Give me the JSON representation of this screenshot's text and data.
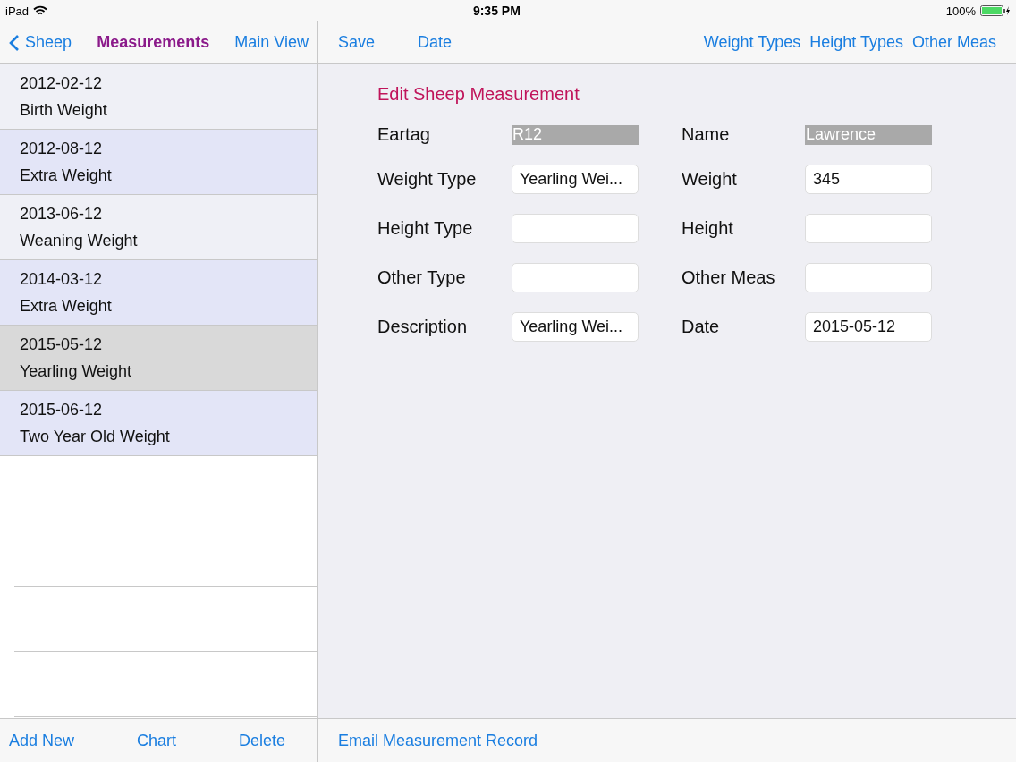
{
  "status_bar": {
    "device": "iPad",
    "time": "9:35 PM",
    "battery": "100%"
  },
  "master_nav": {
    "back": "Sheep",
    "title": "Measurements",
    "right": "Main View"
  },
  "detail_nav": {
    "left": [
      "Save",
      "Date"
    ],
    "right": [
      "Weight Types",
      "Height Types",
      "Other Meas"
    ]
  },
  "list": [
    {
      "date": "2012-02-12",
      "type": "Birth Weight",
      "selected": false
    },
    {
      "date": "2012-08-12",
      "type": "Extra Weight",
      "selected": false
    },
    {
      "date": "2013-06-12",
      "type": "Weaning Weight",
      "selected": false
    },
    {
      "date": "2014-03-12",
      "type": "Extra Weight",
      "selected": false
    },
    {
      "date": "2015-05-12",
      "type": "Yearling Weight",
      "selected": true
    },
    {
      "date": "2015-06-12",
      "type": "Two Year Old Weight",
      "selected": false
    }
  ],
  "form": {
    "title": "Edit Sheep Measurement",
    "fields": [
      {
        "label": "Eartag",
        "value": "R12",
        "kind": "readonly"
      },
      {
        "label": "Name",
        "value": "Lawrence",
        "kind": "readonly"
      },
      {
        "label": "Weight Type",
        "value": "Yearling Wei...",
        "kind": "input"
      },
      {
        "label": "Weight",
        "value": "345",
        "kind": "input"
      },
      {
        "label": "Height Type",
        "kind": "input"
      },
      {
        "label": "Height",
        "kind": "input"
      },
      {
        "label": "Other Type",
        "kind": "input"
      },
      {
        "label": "Other Meas",
        "kind": "input"
      },
      {
        "label": "Description",
        "value": "Yearling Wei...",
        "kind": "input"
      },
      {
        "label": "Date",
        "value": "2015-05-12",
        "kind": "input"
      }
    ]
  },
  "master_toolbar": [
    "Add New",
    "Chart",
    "Delete"
  ],
  "detail_toolbar": [
    "Email Measurement Record"
  ]
}
